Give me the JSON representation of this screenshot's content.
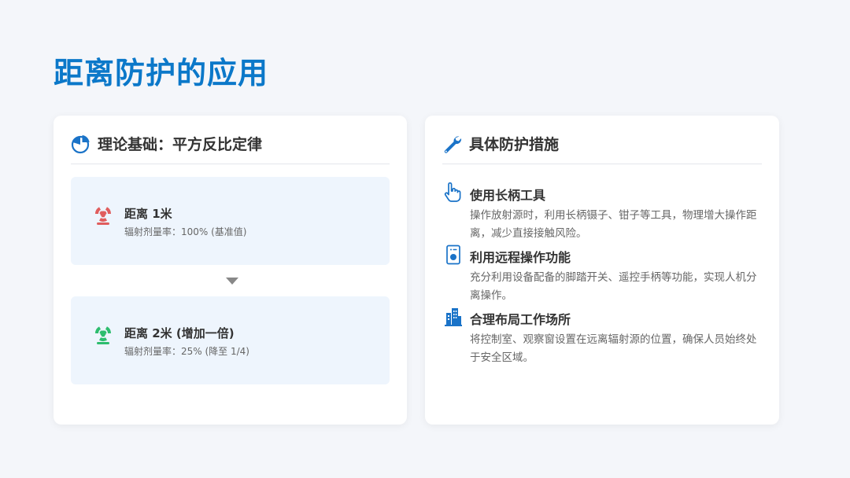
{
  "page": {
    "title": "距离防护的应用"
  },
  "left_card": {
    "title": "理论基础：平方反比定律",
    "icon": "pie-chart-icon",
    "items": [
      {
        "icon": "radiation-icon",
        "icon_color": "#e05d5d",
        "title": "距离 1米",
        "subtitle": "辐射剂量率：100% (基准值)"
      },
      {
        "icon": "radiation-icon",
        "icon_color": "#2dbd6e",
        "title": "距离 2米 (增加一倍)",
        "subtitle": "辐射剂量率：25% (降至 1/4)"
      }
    ],
    "arrow_icon": "arrow-down-icon"
  },
  "right_card": {
    "title": "具体防护措施",
    "icon": "wrench-icon",
    "items": [
      {
        "icon": "hand-pointer-icon",
        "title": "使用长柄工具",
        "desc": "操作放射源时，利用长柄镊子、钳子等工具，物理增大操作距离，减少直接接触风险。"
      },
      {
        "icon": "remote-control-icon",
        "title": "利用远程操作功能",
        "desc": "充分利用设备配备的脚踏开关、遥控手柄等功能，实现人机分离操作。"
      },
      {
        "icon": "building-icon",
        "title": "合理布局工作场所",
        "desc": "将控制室、观察窗设置在远离辐射源的位置，确保人员始终处于安全区域。"
      }
    ]
  },
  "colors": {
    "accent": "#0b78c9",
    "icon_blue": "#1a73c8",
    "danger": "#e05d5d",
    "safe": "#2dbd6e"
  }
}
